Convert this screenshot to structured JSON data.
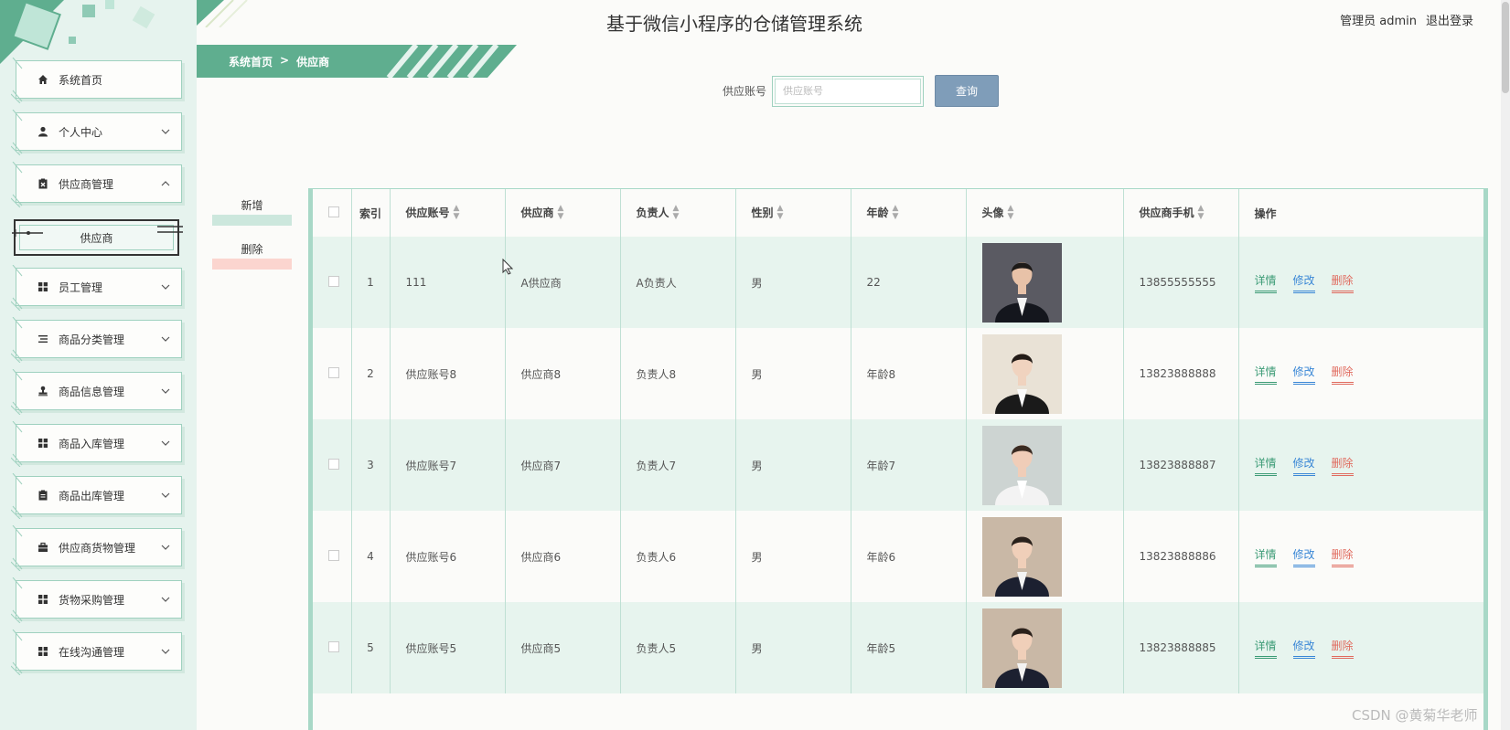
{
  "header": {
    "title": "基于微信小程序的仓储管理系统",
    "admin_label": "管理员 admin",
    "logout_label": "退出登录"
  },
  "breadcrumb": {
    "home": "系统首页",
    "separator": ">",
    "current": "供应商"
  },
  "sidebar": {
    "items": [
      {
        "label": "系统首页",
        "icon": "home-icon",
        "has_arrow": false
      },
      {
        "label": "个人中心",
        "icon": "user-icon",
        "has_arrow": true
      },
      {
        "label": "供应商管理",
        "icon": "clipboard-x-icon",
        "has_arrow": true,
        "expanded": true
      },
      {
        "label": "员工管理",
        "icon": "grid-icon",
        "has_arrow": true
      },
      {
        "label": "商品分类管理",
        "icon": "list-icon",
        "has_arrow": true
      },
      {
        "label": "商品信息管理",
        "icon": "stamp-icon",
        "has_arrow": true
      },
      {
        "label": "商品入库管理",
        "icon": "grid-icon",
        "has_arrow": true
      },
      {
        "label": "商品出库管理",
        "icon": "clipboard-icon",
        "has_arrow": true
      },
      {
        "label": "供应商货物管理",
        "icon": "briefcase-icon",
        "has_arrow": true
      },
      {
        "label": "货物采购管理",
        "icon": "grid-icon",
        "has_arrow": true
      },
      {
        "label": "在线沟通管理",
        "icon": "grid-icon",
        "has_arrow": true
      }
    ],
    "sub_active": "供应商"
  },
  "search": {
    "label": "供应账号",
    "placeholder": "供应账号",
    "value": "",
    "button": "查询"
  },
  "actions": {
    "add": "新增",
    "delete": "删除"
  },
  "table": {
    "columns": [
      "索引",
      "供应账号",
      "供应商",
      "负责人",
      "性别",
      "年龄",
      "头像",
      "供应商手机",
      "操作"
    ],
    "rows": [
      {
        "index": "1",
        "account": "111",
        "supplier": "A供应商",
        "manager": "A负责人",
        "gender": "男",
        "age": "22",
        "avatar": "man-suit",
        "phone": "13855555555"
      },
      {
        "index": "2",
        "account": "供应账号8",
        "supplier": "供应商8",
        "manager": "负责人8",
        "gender": "男",
        "age": "年龄8",
        "avatar": "woman-uniform",
        "phone": "13823888888"
      },
      {
        "index": "3",
        "account": "供应账号7",
        "supplier": "供应商7",
        "manager": "负责人7",
        "gender": "男",
        "age": "年龄7",
        "avatar": "woman-white-shirt",
        "phone": "13823888887"
      },
      {
        "index": "4",
        "account": "供应账号6",
        "supplier": "供应商6",
        "manager": "负责人6",
        "gender": "男",
        "age": "年龄6",
        "avatar": "man-tuxedo",
        "phone": "13823888886"
      },
      {
        "index": "5",
        "account": "供应账号5",
        "supplier": "供应商5",
        "manager": "负责人5",
        "gender": "男",
        "age": "年龄5",
        "avatar": "man-tuxedo",
        "phone": "13823888885"
      }
    ],
    "ops": {
      "detail": "详情",
      "edit": "修改",
      "delete": "删除"
    }
  },
  "colors": {
    "accent": "#5fae8f",
    "add_bar": "#cce7dd",
    "delete_bar": "#fbd5cf",
    "query_button": "#7f9db9"
  },
  "watermark": "CSDN @黄菊华老师"
}
